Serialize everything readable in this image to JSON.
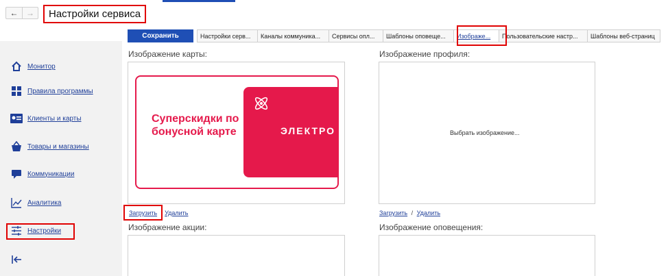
{
  "header": {
    "title": "Настройки сервиса",
    "back_icon": "←",
    "forward_icon": "→"
  },
  "sidebar": {
    "items": [
      {
        "label": "Монитор",
        "icon": "home-icon"
      },
      {
        "label": "Правила программы",
        "icon": "rules-grid-icon"
      },
      {
        "label": "Клиенты и карты",
        "icon": "id-card-icon"
      },
      {
        "label": "Товары и магазины",
        "icon": "basket-icon"
      },
      {
        "label": "Коммуникации",
        "icon": "chat-icon"
      },
      {
        "label": "Аналитика",
        "icon": "chart-icon"
      },
      {
        "label": "Настройки",
        "icon": "sliders-icon"
      }
    ],
    "collapse_icon": "collapse-arrow-icon"
  },
  "toolbar": {
    "save_label": "Сохранить",
    "tabs": [
      {
        "label": "Настройки серв..."
      },
      {
        "label": "Каналы коммуника..."
      },
      {
        "label": "Сервисы опл..."
      },
      {
        "label": "Шаблоны оповеще..."
      },
      {
        "label": "Изображе...",
        "active": true
      },
      {
        "label": "Пользовательские настр..."
      },
      {
        "label": "Шаблоны веб-страниц"
      }
    ]
  },
  "sections": {
    "card_image": {
      "label": "Изображение карты:",
      "upload": "Загрузить",
      "delete": "Удалить",
      "card_text": "Суперскидки по бонусной карте",
      "card_brand": "ЭЛЕКТРО"
    },
    "profile_image": {
      "label": "Изображение профиля:",
      "placeholder": "Выбрать изображение...",
      "upload": "Загрузить",
      "separator": "/",
      "delete": "Удалить"
    },
    "promo_image": {
      "label": "Изображение акции:"
    },
    "notification_image": {
      "label": "Изображение оповещения:"
    }
  },
  "colors": {
    "accent": "#1f4fb5",
    "link": "#1f3f99",
    "highlight": "#e00000",
    "card_red": "#e5194b",
    "sidebar_bg": "#f2f2f2"
  }
}
